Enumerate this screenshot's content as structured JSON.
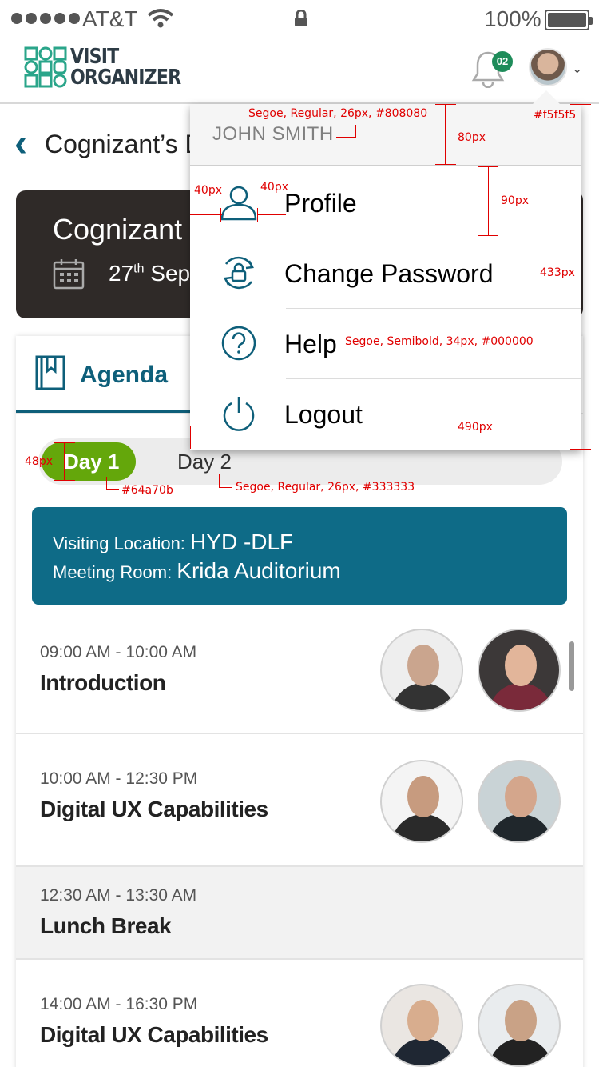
{
  "status_bar": {
    "carrier": "AT&T",
    "battery": "100%"
  },
  "header": {
    "logo_line1": "VISIT",
    "logo_line2": "ORGANIZER",
    "notification_count": "02"
  },
  "page": {
    "title": "Cognizant’s D"
  },
  "event_card": {
    "title": "Cognizant",
    "date_day": "27",
    "date_suffix": "th",
    "date_rest": " Sep"
  },
  "agenda": {
    "tab_label": "Agenda",
    "day1": "Day 1",
    "day2": "Day 2",
    "location_label": "Visiting Location: ",
    "location_value": "HYD -DLF",
    "room_label": "Meeting Room: ",
    "room_value": "Krida Auditorium",
    "sessions": [
      {
        "time": "09:00 AM - 10:00 AM",
        "title": "Introduction"
      },
      {
        "time": "10:00 AM - 12:30 PM",
        "title": "Digital UX Capabilities"
      },
      {
        "time": "12:30 AM - 13:30 AM",
        "title": "Lunch Break"
      },
      {
        "time": "14:00 AM - 16:30 PM",
        "title": "Digital UX Capabilities"
      }
    ]
  },
  "dropdown": {
    "user_name": "JOHN SMITH",
    "items": [
      {
        "label": "Profile",
        "icon": "user-icon"
      },
      {
        "label": "Change Password",
        "icon": "lock-refresh-icon"
      },
      {
        "label": "Help",
        "icon": "question-icon"
      },
      {
        "label": "Logout",
        "icon": "power-icon"
      }
    ]
  },
  "annotations": {
    "user_spec": "Segoe, Regular, 26px, #808080",
    "header_bg": "#f5f5f5",
    "h80": "80px",
    "w40a": "40px",
    "w40b": "40px",
    "h90": "90px",
    "h433": "433px",
    "help_spec": "Segoe, Semibold, 34px, #000000",
    "w490": "490px",
    "h48": "48px",
    "day1_color": "#64a70b",
    "day2_spec": "Segoe, Regular, 26px, #333333"
  },
  "colors": {
    "accent": "#0e5f7a",
    "location_bg": "#0e6b87",
    "green": "#64a70b",
    "dark_card": "#2f2a28"
  }
}
